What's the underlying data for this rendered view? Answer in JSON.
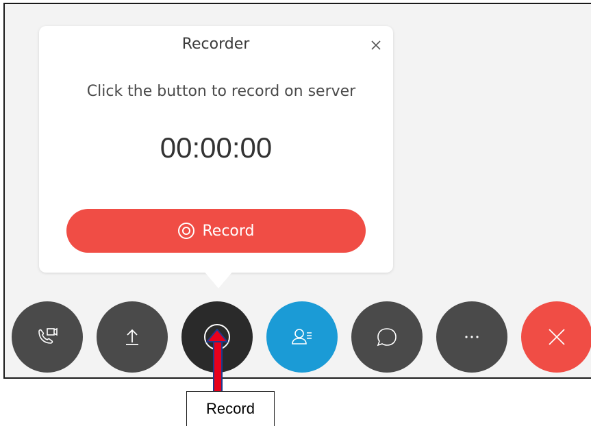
{
  "recorder": {
    "title": "Recorder",
    "instruction": "Click the button to record on server",
    "timer": "00:00:00",
    "record_label": "Record"
  },
  "controls": [
    {
      "name": "call-video-button",
      "icon": "phone-video-icon"
    },
    {
      "name": "share-button",
      "icon": "upload-icon"
    },
    {
      "name": "record-button",
      "icon": "record-icon"
    },
    {
      "name": "participants-button",
      "icon": "participants-list-icon"
    },
    {
      "name": "chat-button",
      "icon": "chat-bubble-icon"
    },
    {
      "name": "more-button",
      "icon": "more-icon"
    },
    {
      "name": "end-call-button",
      "icon": "close-icon"
    }
  ],
  "annotation": {
    "callout_label": "Record"
  },
  "colors": {
    "record_red": "#f04d45",
    "participants_blue": "#1b9bd6",
    "control_dark": "#4a4a4a",
    "arrow_red": "#e8001c"
  }
}
